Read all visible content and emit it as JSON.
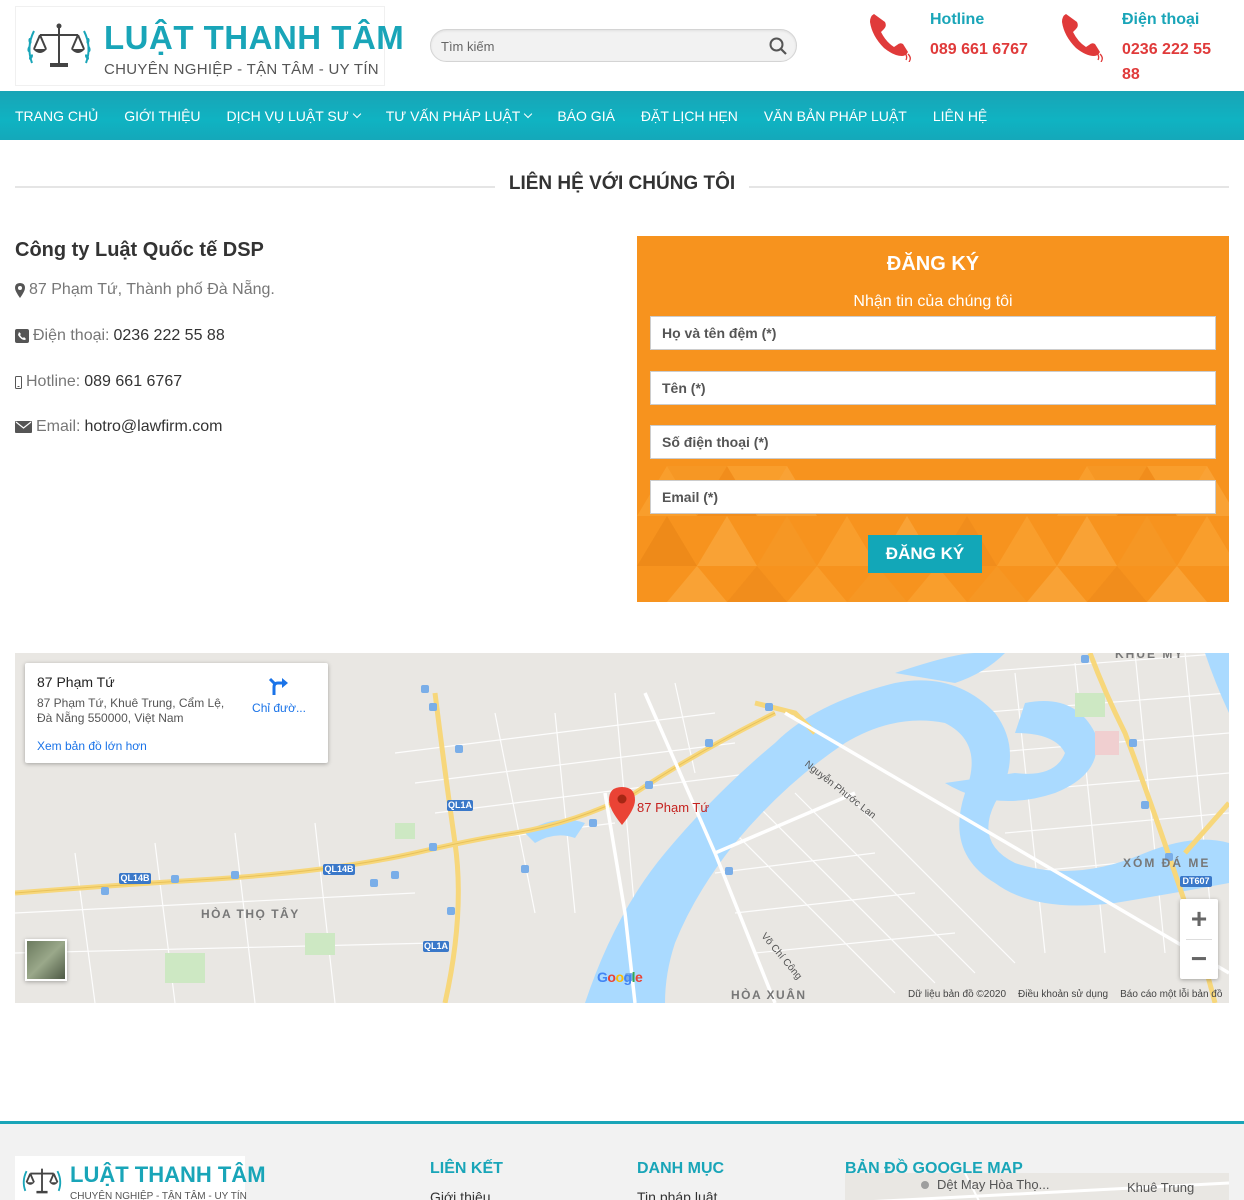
{
  "header": {
    "logo_title": "LUẬT THANH TÂM",
    "logo_subtitle": "CHUYÊN NGHIỆP - TẬN TÂM - UY TÍN",
    "search_placeholder": "Tìm kiếm",
    "hotline_label": "Hotline",
    "hotline_number": "089 661 6767",
    "phone_label": "Điện thoại",
    "phone_number_line1": "0236 222 55",
    "phone_number_line2": "88"
  },
  "nav": {
    "items": [
      {
        "label": "TRANG CHỦ",
        "dropdown": false
      },
      {
        "label": "GIỚI THIỆU",
        "dropdown": false
      },
      {
        "label": "DỊCH VỤ LUẬT SƯ",
        "dropdown": true
      },
      {
        "label": "TƯ VẤN PHÁP LUẬT",
        "dropdown": true
      },
      {
        "label": "BÁO GIÁ",
        "dropdown": false
      },
      {
        "label": "ĐẶT LỊCH HẸN",
        "dropdown": false
      },
      {
        "label": "VĂN BẢN PHÁP LUẬT",
        "dropdown": false
      },
      {
        "label": "LIÊN HỆ",
        "dropdown": false
      }
    ]
  },
  "contact": {
    "section_title": "LIÊN HỆ VỚI CHÚNG TÔI",
    "company_name": "Công ty Luật Quốc tế DSP",
    "address": "87 Phạm Tứ, Thành phố Đà Nẵng.",
    "phone_label": "Điện thoại:",
    "phone_value": "0236 222 55 88",
    "hotline_label": "Hotline:",
    "hotline_value": "089 661 6767",
    "email_label": "Email:",
    "email_value": "hotro@lawfirm.com"
  },
  "form": {
    "title": "ĐĂNG KÝ",
    "subtitle": "Nhận tin của chúng tôi",
    "fields": [
      {
        "placeholder": "Họ và tên đệm (*)"
      },
      {
        "placeholder": "Tên (*)"
      },
      {
        "placeholder": "Số điện thoại (*)"
      },
      {
        "placeholder": "Email (*)"
      }
    ],
    "submit_label": "ĐĂNG KÝ",
    "accent_color": "#f7931e"
  },
  "map": {
    "card_title": "87 Phạm Tứ",
    "card_address": "87 Phạm Tứ, Khuê Trung, Cẩm Lệ, Đà Nẵng 550000, Việt Nam",
    "card_directions": "Chỉ đườ...",
    "card_larger_map": "Xem bản đồ lớn hơn",
    "marker_label": "87 Phạm Tứ",
    "zoom_in": "+",
    "zoom_out": "−",
    "google": "Google",
    "attr_data": "Dữ liệu bản đồ ©2020",
    "attr_terms": "Điều khoản sử dụng",
    "attr_report": "Báo cáo một lỗi bản đồ",
    "place_labels": {
      "khue_my": "KHUÊ MỸ",
      "xom_da_me": "XÓM ĐÁ ME",
      "hoa_tho_tay": "HÒA THỌ TÂY",
      "hoa_xuan": "HÒA XUÂN",
      "nguyen_phuoc_lan": "Nguyễn Phước Lan",
      "vo_chi_cong": "Võ Chí Công",
      "ql1a_1": "QL1A",
      "ql1a_2": "QL1A",
      "ql14b_1": "QL14B",
      "ql14b_2": "QL14B",
      "dt607": "DT607"
    }
  },
  "footer": {
    "logo_title": "LUẬT THANH TÂM",
    "logo_subtitle": "CHUYÊN NGHIỆP - TẬN TÂM - UY TÍN",
    "col1_title": "LIÊN KẾT",
    "col1_first_link": "Giới thiệu",
    "col2_title": "DANH MỤC",
    "col2_first_link": "Tin pháp luật",
    "col3_title": "BẢN ĐỒ GOOGLE MAP",
    "map_label1": "Dệt May Hòa Thọ...",
    "map_label2": "Khuê Trung"
  },
  "colors": {
    "brand_teal": "#19a5b8",
    "accent_red": "#e03a3a",
    "form_orange": "#f7931e"
  }
}
